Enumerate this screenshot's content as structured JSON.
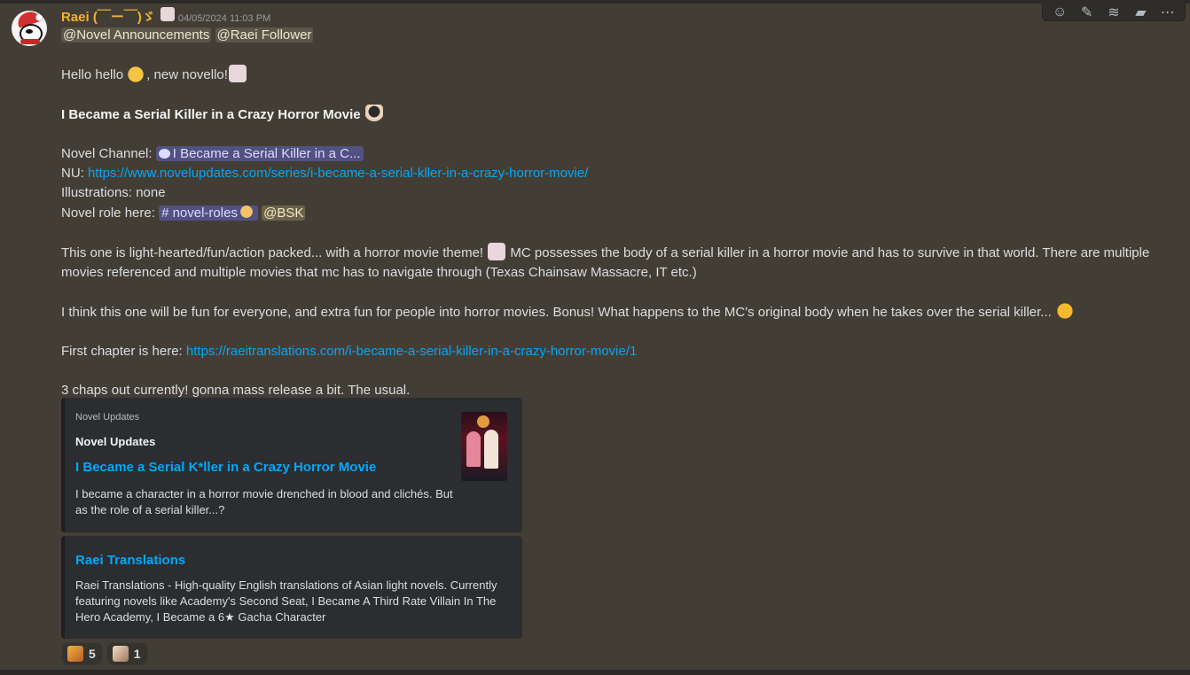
{
  "toolbar": {
    "icons": [
      "add-reaction-icon",
      "edit-icon",
      "threads-icon",
      "announce-icon",
      "more-icon"
    ],
    "glyphs": [
      "☺",
      "✎",
      "≋",
      "▰",
      "⋯"
    ]
  },
  "message": {
    "author": "Raei (￣ー￣)ゞ",
    "timestamp": "04/05/2024 11:03 PM",
    "mentions": [
      "@Novel Announcements",
      "@Raei Follower"
    ],
    "greeting_pre": "Hello hello",
    "greeting_post": ", new novello!",
    "novel_title": "I Became a Serial Killer in a Crazy Horror Movie",
    "channel_label": "Novel Channel: ",
    "channel_name": "I Became a Serial Killer in a C...",
    "nu_label": "NU: ",
    "nu_link": "https://www.novelupdates.com/series/i-became-a-serial-kller-in-a-crazy-horror-movie/",
    "illustrations": "Illustrations: none",
    "role_label": "Novel role here: ",
    "role_channel": "# novel-roles",
    "role_mention": "@BSK",
    "para1_pre": "This one is light-hearted/fun/action packed... with a horror movie theme!",
    "para1_post": " MC possesses the body of a serial killer in a horror movie and has to survive in that world. There are multiple movies referenced and multiple movies that mc has to navigate through (Texas Chainsaw Massacre, IT etc.)",
    "para2": "I think this one will be fun for everyone, and extra fun for people into horror movies. Bonus! What happens to the MC's original body when he takes over the serial killer...",
    "first_chapter_label": "First chapter is here: ",
    "first_chapter_link": "https://raeitranslations.com/i-became-a-serial-killer-in-a-crazy-horror-movie/1",
    "closing": "3 chaps out currently! gonna mass release a bit. The usual."
  },
  "embeds": [
    {
      "provider": "Novel Updates",
      "author": "Novel Updates",
      "title": "I Became a Serial K*ller in a Crazy Horror Movie",
      "description": "I became a character in a horror movie drenched in blood and clichés. But as the role of a serial killer...?"
    },
    {
      "title": "Raei Translations",
      "description": "Raei Translations - High-quality English translations of Asian light novels. Currently featuring novels like Academy's Second Seat, I Became A Third Rate Villain In The Hero Academy, I Became a 6★ Gacha Character"
    }
  ],
  "reactions": [
    {
      "emoji": "custom-emoji-1",
      "count": "5"
    },
    {
      "emoji": "custom-emoji-2",
      "count": "1"
    }
  ],
  "colors": {
    "background": "#433e35",
    "username": "#f0b232",
    "link": "#00a8fc",
    "embed_bg": "#2b2d31"
  }
}
